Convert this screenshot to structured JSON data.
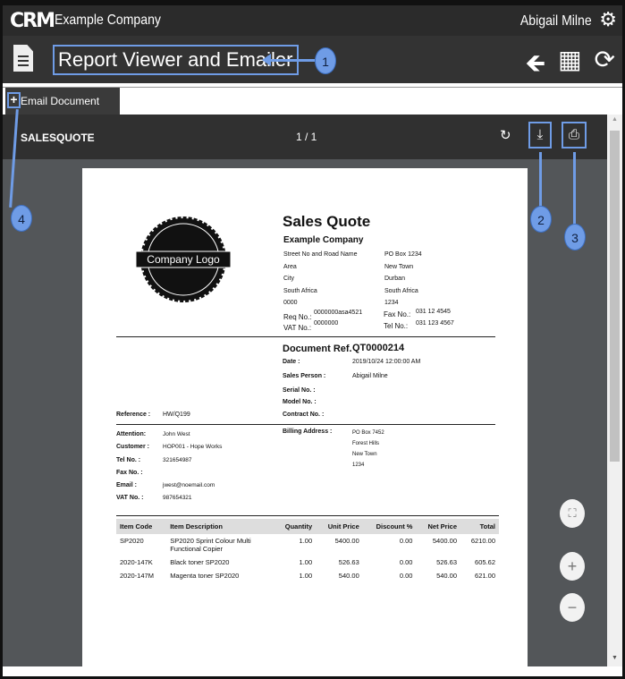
{
  "app": {
    "logo": "CRM",
    "company": "Example Company",
    "user": "Abigail Milne",
    "icons": [
      "gear-icon",
      "document-icon",
      "back-arrow-icon",
      "building-icon",
      "refresh-icon"
    ]
  },
  "header": {
    "title": "Report Viewer and Emailer"
  },
  "tab": {
    "plus": "+",
    "label": "Email Document"
  },
  "viewer": {
    "report_name": "SALESQUOTE",
    "page": "1 / 1",
    "rotate": "↻",
    "download": "⤓",
    "print": "⎙"
  },
  "doc": {
    "title": "Sales Quote",
    "logo_text": "Company Logo",
    "company": "Example Company",
    "addr1": [
      "Street No and Road Name",
      "Area",
      "City",
      "South Africa",
      "0000"
    ],
    "addr2": [
      "PO Box 1234",
      "New Town",
      "Durban",
      "South Africa",
      "1234"
    ],
    "req_label": "Req No.:",
    "req": "0000000asa4521",
    "vat_label": "VAT No.:",
    "vat": "0000000",
    "fax_label": "Fax No.:",
    "fax": "031 12 4545",
    "tel_label": "Tel No.:",
    "tel": "031 123 4567",
    "docref_label": "Document Ref.",
    "docref": "QT0000214",
    "date_label": "Date :",
    "date": "2019/10/24 12:00:00 AM",
    "sales_label": "Sales Person :",
    "sales": "Abigail Milne",
    "serial_label": "Serial No. :",
    "model_label": "Model No. :",
    "contract_label": "Contract No. :",
    "ref_label": "Reference :",
    "ref": "HW/Q199",
    "att_label": "Attention:",
    "att": "John West",
    "cust_label": "Customer :",
    "cust": "HOP001 - Hope Works",
    "ctel_label": "Tel No. :",
    "ctel": "321654987",
    "cfax_label": "Fax No. :",
    "email_label": "Email :",
    "email": "jwest@noemail.com",
    "cvat_label": "VAT No. :",
    "cvat": "987654321",
    "bill_label": "Billing Address :",
    "bill": [
      "PO Box 7452",
      "Forest Hills",
      "New Town",
      "1234"
    ],
    "columns": [
      "Item Code",
      "Item Description",
      "Quantity",
      "Unit Price",
      "Discount %",
      "Net Price",
      "Total"
    ],
    "rows": [
      [
        "SP2020",
        "SP2020 Sprint Colour Multi Functional Copier",
        "1.00",
        "5400.00",
        "0.00",
        "5400.00",
        "6210.00"
      ],
      [
        "2020-147K",
        "Black toner SP2020",
        "1.00",
        "526.63",
        "0.00",
        "526.63",
        "605.62"
      ],
      [
        "2020-147M",
        "Magenta toner SP2020",
        "1.00",
        "540.00",
        "0.00",
        "540.00",
        "621.00"
      ]
    ]
  },
  "zoom": {
    "fit": "⛶",
    "in": "+",
    "out": "−"
  },
  "annotations": [
    "1",
    "2",
    "3",
    "4"
  ],
  "colors": {
    "annotation": "#6f9ce6",
    "topbar": "#2b2b2b",
    "viewer_bg": "#535659"
  }
}
